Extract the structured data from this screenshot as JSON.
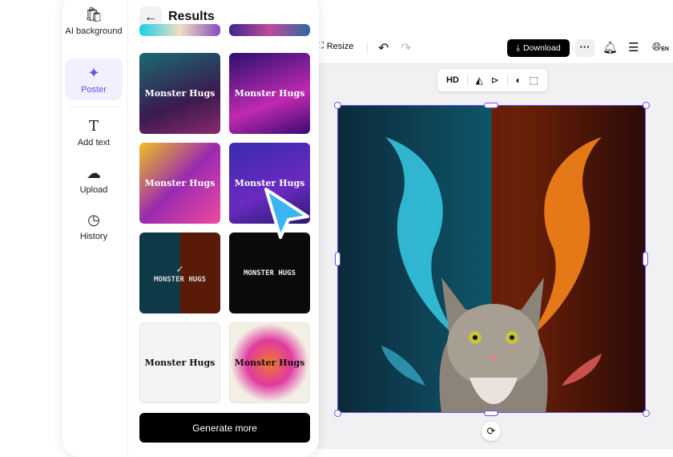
{
  "sidebar": {
    "items": [
      {
        "label": "AI background",
        "icon": "bag-icon"
      },
      {
        "label": "Poster",
        "icon": "poster-icon",
        "active": true
      },
      {
        "label": "Add text",
        "icon": "text-icon"
      },
      {
        "label": "Upload",
        "icon": "upload-cloud-icon"
      },
      {
        "label": "History",
        "icon": "clock-icon"
      }
    ]
  },
  "results": {
    "title": "Results",
    "generate_label": "Generate more",
    "thumbnails": [
      {
        "text": "Monster Hugs"
      },
      {
        "text": "Monster Hugs"
      },
      {
        "text": "Monster Hugs"
      },
      {
        "text": "Monster Hugs"
      },
      {
        "text": "MONSTER HUGS",
        "selected": true
      },
      {
        "text": "MONSTER HUGS"
      },
      {
        "text": "Monster Hugs"
      },
      {
        "text": "Monster Hugs"
      }
    ]
  },
  "toolbar": {
    "resize": "Resize",
    "download": "Download",
    "lang": "EN"
  },
  "floatbar": {
    "hd": "HD"
  },
  "colors": {
    "accent": "#6b4ef0",
    "cursor": "#3ab4f2"
  }
}
